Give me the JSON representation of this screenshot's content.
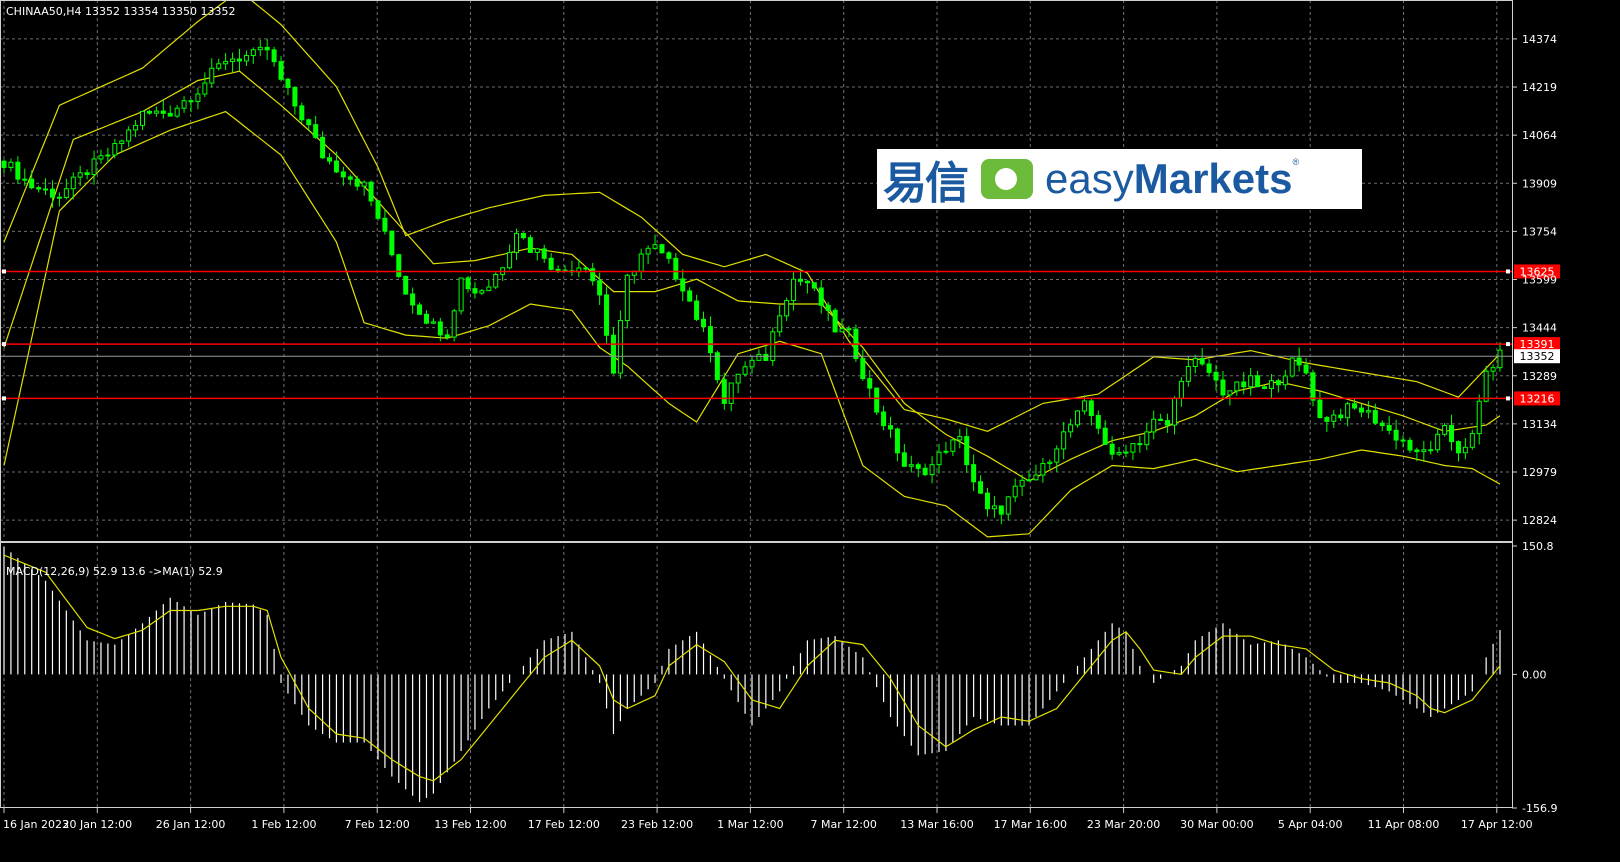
{
  "header": {
    "price_title": "CHINAA50,H4  13352 13354 13350 13352",
    "macd_title": "MACD(12,26,9) 52.9 13.6  ->MA(1) 52.9"
  },
  "logo": {
    "cn": "易信",
    "en_light": "easy",
    "en_bold": "Markets",
    "reg": "®"
  },
  "colors": {
    "background": "#000000",
    "grid": "#6e6e6e",
    "candle": "#00ff00",
    "bands": "#e0e000",
    "level": "#ff0000",
    "histogram": "#ffffff",
    "signal": "#e0e000"
  },
  "chart_data": [
    {
      "type": "candlestick",
      "title": "CHINAA50,H4",
      "symbol": "CHINAA50",
      "timeframe": "H4",
      "ohlc_last": {
        "open": 13352,
        "high": 13354,
        "low": 13350,
        "close": 13352
      },
      "ylim": [
        12760,
        14480
      ],
      "yticks": [
        14374,
        14219,
        14064,
        13909,
        13754,
        13599,
        13444,
        13289,
        13134,
        12979,
        12824
      ],
      "xtick_labels": [
        "16 Jan 2023",
        "20 Jan 12:00",
        "26 Jan 12:00",
        "1 Feb 12:00",
        "7 Feb 12:00",
        "13 Feb 12:00",
        "17 Feb 12:00",
        "23 Feb 12:00",
        "1 Mar 12:00",
        "7 Mar 12:00",
        "13 Mar 16:00",
        "17 Mar 16:00",
        "23 Mar 20:00",
        "30 Mar 00:00",
        "5 Apr 04:00",
        "11 Apr 08:00",
        "17 Apr 12:00"
      ],
      "close_path": [
        [
          0,
          13980
        ],
        [
          4,
          13900
        ],
        [
          8,
          13870
        ],
        [
          12,
          13950
        ],
        [
          16,
          14020
        ],
        [
          20,
          14130
        ],
        [
          24,
          14140
        ],
        [
          28,
          14210
        ],
        [
          32,
          14310
        ],
        [
          36,
          14320
        ],
        [
          38,
          14340
        ],
        [
          40,
          14240
        ],
        [
          42,
          14160
        ],
        [
          44,
          14090
        ],
        [
          46,
          14000
        ],
        [
          48,
          13960
        ],
        [
          50,
          13930
        ],
        [
          52,
          13900
        ],
        [
          54,
          13800
        ],
        [
          56,
          13680
        ],
        [
          58,
          13560
        ],
        [
          60,
          13500
        ],
        [
          62,
          13450
        ],
        [
          64,
          13430
        ],
        [
          66,
          13600
        ],
        [
          68,
          13560
        ],
        [
          70,
          13580
        ],
        [
          72,
          13650
        ],
        [
          74,
          13760
        ],
        [
          76,
          13700
        ],
        [
          78,
          13680
        ],
        [
          80,
          13620
        ],
        [
          82,
          13640
        ],
        [
          84,
          13650
        ],
        [
          86,
          13550
        ],
        [
          88,
          13300
        ],
        [
          90,
          13600
        ],
        [
          92,
          13680
        ],
        [
          94,
          13700
        ],
        [
          96,
          13650
        ],
        [
          98,
          13580
        ],
        [
          100,
          13480
        ],
        [
          102,
          13380
        ],
        [
          104,
          13200
        ],
        [
          106,
          13300
        ],
        [
          108,
          13330
        ],
        [
          110,
          13350
        ],
        [
          112,
          13500
        ],
        [
          114,
          13600
        ],
        [
          116,
          13590
        ],
        [
          118,
          13520
        ],
        [
          120,
          13440
        ],
        [
          122,
          13420
        ],
        [
          124,
          13300
        ],
        [
          126,
          13180
        ],
        [
          128,
          13100
        ],
        [
          130,
          13000
        ],
        [
          132,
          12980
        ],
        [
          134,
          13000
        ],
        [
          136,
          13060
        ],
        [
          138,
          13080
        ],
        [
          140,
          12950
        ],
        [
          142,
          12850
        ],
        [
          144,
          12860
        ],
        [
          146,
          12920
        ],
        [
          148,
          12950
        ],
        [
          150,
          12990
        ],
        [
          152,
          13070
        ],
        [
          154,
          13130
        ],
        [
          156,
          13190
        ],
        [
          158,
          13130
        ],
        [
          160,
          13020
        ],
        [
          162,
          13060
        ],
        [
          164,
          13080
        ],
        [
          166,
          13140
        ],
        [
          168,
          13130
        ],
        [
          170,
          13290
        ],
        [
          172,
          13330
        ],
        [
          174,
          13300
        ],
        [
          176,
          13240
        ],
        [
          178,
          13250
        ],
        [
          180,
          13270
        ],
        [
          182,
          13240
        ],
        [
          184,
          13280
        ],
        [
          186,
          13330
        ],
        [
          188,
          13300
        ],
        [
          190,
          13150
        ],
        [
          192,
          13160
        ],
        [
          194,
          13180
        ],
        [
          196,
          13180
        ],
        [
          198,
          13150
        ],
        [
          200,
          13110
        ],
        [
          202,
          13080
        ],
        [
          204,
          13030
        ],
        [
          206,
          13060
        ],
        [
          208,
          13110
        ],
        [
          210,
          13050
        ],
        [
          212,
          13090
        ],
        [
          214,
          13300
        ],
        [
          216,
          13352
        ]
      ],
      "bollinger": {
        "middle": [
          [
            0,
            13380
          ],
          [
            10,
            14050
          ],
          [
            20,
            14140
          ],
          [
            28,
            14240
          ],
          [
            34,
            14270
          ],
          [
            40,
            14160
          ],
          [
            48,
            14000
          ],
          [
            56,
            13800
          ],
          [
            62,
            13650
          ],
          [
            68,
            13660
          ],
          [
            76,
            13700
          ],
          [
            82,
            13680
          ],
          [
            88,
            13560
          ],
          [
            94,
            13560
          ],
          [
            100,
            13600
          ],
          [
            106,
            13530
          ],
          [
            112,
            13520
          ],
          [
            118,
            13520
          ],
          [
            124,
            13380
          ],
          [
            130,
            13200
          ],
          [
            136,
            13100
          ],
          [
            142,
            13030
          ],
          [
            148,
            12950
          ],
          [
            154,
            13020
          ],
          [
            160,
            13080
          ],
          [
            166,
            13110
          ],
          [
            172,
            13160
          ],
          [
            178,
            13240
          ],
          [
            184,
            13270
          ],
          [
            190,
            13240
          ],
          [
            196,
            13200
          ],
          [
            202,
            13160
          ],
          [
            208,
            13110
          ],
          [
            214,
            13130
          ],
          [
            216,
            13160
          ]
        ],
        "upper": [
          [
            0,
            13720
          ],
          [
            8,
            14160
          ],
          [
            20,
            14280
          ],
          [
            28,
            14430
          ],
          [
            34,
            14530
          ],
          [
            40,
            14420
          ],
          [
            48,
            14220
          ],
          [
            54,
            13960
          ],
          [
            58,
            13740
          ],
          [
            64,
            13790
          ],
          [
            70,
            13830
          ],
          [
            78,
            13870
          ],
          [
            86,
            13880
          ],
          [
            92,
            13800
          ],
          [
            98,
            13680
          ],
          [
            104,
            13640
          ],
          [
            110,
            13680
          ],
          [
            116,
            13620
          ],
          [
            122,
            13400
          ],
          [
            130,
            13180
          ],
          [
            136,
            13150
          ],
          [
            142,
            13110
          ],
          [
            150,
            13200
          ],
          [
            158,
            13230
          ],
          [
            166,
            13350
          ],
          [
            172,
            13340
          ],
          [
            180,
            13370
          ],
          [
            188,
            13330
          ],
          [
            196,
            13300
          ],
          [
            204,
            13270
          ],
          [
            210,
            13220
          ],
          [
            216,
            13360
          ]
        ],
        "lower": [
          [
            0,
            13000
          ],
          [
            8,
            13820
          ],
          [
            16,
            14000
          ],
          [
            24,
            14080
          ],
          [
            32,
            14140
          ],
          [
            40,
            14000
          ],
          [
            48,
            13720
          ],
          [
            52,
            13460
          ],
          [
            58,
            13420
          ],
          [
            64,
            13410
          ],
          [
            70,
            13450
          ],
          [
            76,
            13520
          ],
          [
            82,
            13500
          ],
          [
            86,
            13380
          ],
          [
            90,
            13320
          ],
          [
            96,
            13200
          ],
          [
            100,
            13140
          ],
          [
            106,
            13360
          ],
          [
            112,
            13400
          ],
          [
            118,
            13360
          ],
          [
            124,
            13000
          ],
          [
            130,
            12900
          ],
          [
            136,
            12870
          ],
          [
            142,
            12770
          ],
          [
            148,
            12780
          ],
          [
            154,
            12920
          ],
          [
            160,
            13000
          ],
          [
            166,
            12990
          ],
          [
            172,
            13020
          ],
          [
            178,
            12980
          ],
          [
            184,
            13000
          ],
          [
            190,
            13020
          ],
          [
            196,
            13050
          ],
          [
            202,
            13030
          ],
          [
            208,
            13000
          ],
          [
            212,
            12990
          ],
          [
            216,
            12940
          ]
        ]
      },
      "levels": [
        {
          "label": "13625",
          "value": 13625
        },
        {
          "label": "13391",
          "value": 13391
        },
        {
          "label": "13216",
          "value": 13216
        }
      ],
      "current_price": {
        "label": "13352",
        "value": 13352
      }
    },
    {
      "type": "bar",
      "title": "MACD(12,26,9) 52.9 13.6  ->MA(1) 52.9",
      "ylim": [
        -156.9,
        150.8
      ],
      "yticks": [
        {
          "label": "150.8",
          "value": 150.8
        },
        {
          "label": "0.00",
          "value": 0
        },
        {
          "label": "-156.9",
          "value": -156.9
        }
      ],
      "main": 52.9,
      "signal_value": 13.6,
      "histogram": [
        [
          0,
          150
        ],
        [
          6,
          110
        ],
        [
          12,
          40
        ],
        [
          16,
          35
        ],
        [
          20,
          60
        ],
        [
          24,
          90
        ],
        [
          28,
          70
        ],
        [
          32,
          85
        ],
        [
          36,
          82
        ],
        [
          38,
          70
        ],
        [
          40,
          -10
        ],
        [
          44,
          -60
        ],
        [
          48,
          -80
        ],
        [
          52,
          -80
        ],
        [
          56,
          -120
        ],
        [
          60,
          -150
        ],
        [
          62,
          -140
        ],
        [
          66,
          -90
        ],
        [
          70,
          -40
        ],
        [
          74,
          0
        ],
        [
          78,
          40
        ],
        [
          82,
          50
        ],
        [
          86,
          -10
        ],
        [
          88,
          -70
        ],
        [
          90,
          -40
        ],
        [
          94,
          -10
        ],
        [
          96,
          30
        ],
        [
          100,
          50
        ],
        [
          104,
          -5
        ],
        [
          108,
          -60
        ],
        [
          112,
          -20
        ],
        [
          116,
          40
        ],
        [
          120,
          45
        ],
        [
          124,
          20
        ],
        [
          128,
          -50
        ],
        [
          132,
          -95
        ],
        [
          136,
          -90
        ],
        [
          140,
          -50
        ],
        [
          144,
          -60
        ],
        [
          148,
          -60
        ],
        [
          152,
          -20
        ],
        [
          156,
          20
        ],
        [
          160,
          60
        ],
        [
          162,
          50
        ],
        [
          164,
          10
        ],
        [
          166,
          -10
        ],
        [
          170,
          10
        ],
        [
          172,
          40
        ],
        [
          176,
          60
        ],
        [
          180,
          35
        ],
        [
          184,
          40
        ],
        [
          188,
          20
        ],
        [
          192,
          -10
        ],
        [
          196,
          -10
        ],
        [
          200,
          -20
        ],
        [
          204,
          -40
        ],
        [
          206,
          -50
        ],
        [
          208,
          -40
        ],
        [
          212,
          -20
        ],
        [
          214,
          20
        ],
        [
          216,
          52
        ]
      ],
      "signal": [
        [
          0,
          140
        ],
        [
          6,
          120
        ],
        [
          12,
          55
        ],
        [
          16,
          42
        ],
        [
          20,
          52
        ],
        [
          24,
          75
        ],
        [
          28,
          75
        ],
        [
          32,
          80
        ],
        [
          36,
          80
        ],
        [
          38,
          75
        ],
        [
          40,
          20
        ],
        [
          44,
          -40
        ],
        [
          48,
          -70
        ],
        [
          52,
          -75
        ],
        [
          56,
          -100
        ],
        [
          60,
          -120
        ],
        [
          62,
          -125
        ],
        [
          66,
          -100
        ],
        [
          70,
          -60
        ],
        [
          74,
          -20
        ],
        [
          78,
          20
        ],
        [
          82,
          40
        ],
        [
          86,
          10
        ],
        [
          88,
          -30
        ],
        [
          90,
          -40
        ],
        [
          94,
          -25
        ],
        [
          96,
          10
        ],
        [
          100,
          35
        ],
        [
          104,
          15
        ],
        [
          108,
          -30
        ],
        [
          112,
          -40
        ],
        [
          116,
          10
        ],
        [
          120,
          40
        ],
        [
          124,
          35
        ],
        [
          128,
          -5
        ],
        [
          132,
          -60
        ],
        [
          136,
          -85
        ],
        [
          140,
          -65
        ],
        [
          144,
          -50
        ],
        [
          148,
          -55
        ],
        [
          152,
          -40
        ],
        [
          156,
          0
        ],
        [
          160,
          40
        ],
        [
          162,
          50
        ],
        [
          164,
          30
        ],
        [
          166,
          5
        ],
        [
          170,
          0
        ],
        [
          172,
          20
        ],
        [
          176,
          45
        ],
        [
          180,
          45
        ],
        [
          184,
          35
        ],
        [
          188,
          30
        ],
        [
          192,
          5
        ],
        [
          196,
          -5
        ],
        [
          200,
          -10
        ],
        [
          204,
          -25
        ],
        [
          206,
          -40
        ],
        [
          208,
          -45
        ],
        [
          212,
          -30
        ],
        [
          214,
          -10
        ],
        [
          216,
          10
        ]
      ]
    }
  ]
}
